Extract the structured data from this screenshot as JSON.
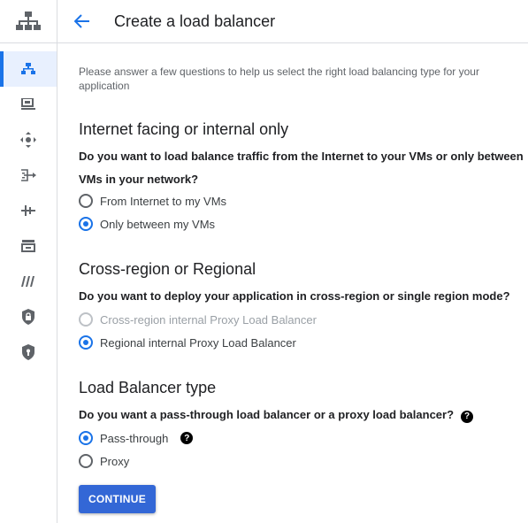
{
  "header": {
    "title": "Create a load balancer"
  },
  "intro": "Please answer a few questions to help us select the right load balancing type for your application",
  "sections": [
    {
      "title": "Internet facing or internal only",
      "question": "Do you want to load balance traffic from the Internet to your VMs or only between VMs in your network?",
      "options": [
        {
          "label": "From Internet to my VMs",
          "checked": false
        },
        {
          "label": "Only between my VMs",
          "checked": true
        }
      ]
    },
    {
      "title": "Cross-region or Regional",
      "question": "Do you want to deploy your application in cross-region or single region mode?",
      "options": [
        {
          "label": "Cross-region internal Proxy Load Balancer",
          "checked": false,
          "disabled": true
        },
        {
          "label": "Regional internal Proxy Load Balancer",
          "checked": true
        }
      ]
    },
    {
      "title": "Load Balancer type",
      "question": "Do you want a pass-through load balancer or a proxy load balancer?",
      "options": [
        {
          "label": "Pass-through",
          "checked": true
        },
        {
          "label": "Proxy",
          "checked": false
        }
      ]
    }
  ],
  "help_glyph": "?",
  "continue_label": "CONTINUE",
  "rail_icons": [
    "network-services-icon",
    "load-balancing-icon",
    "vm-icon",
    "traffic-director-icon",
    "cloud-dns-icon",
    "cdn-icon",
    "nat-icon",
    "service-directory-icon",
    "cloud-armor-icon",
    "secure-web-proxy-icon"
  ],
  "colors": {
    "accent": "#1a73e8",
    "button": "#3367d6",
    "active_bg": "#e8f0fe"
  }
}
